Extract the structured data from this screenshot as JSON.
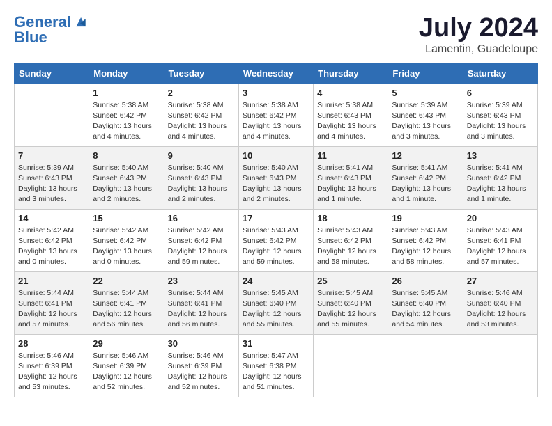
{
  "header": {
    "logo_line1": "General",
    "logo_line2": "Blue",
    "month_year": "July 2024",
    "location": "Lamentin, Guadeloupe"
  },
  "weekdays": [
    "Sunday",
    "Monday",
    "Tuesday",
    "Wednesday",
    "Thursday",
    "Friday",
    "Saturday"
  ],
  "weeks": [
    [
      {
        "day": "",
        "empty": true
      },
      {
        "day": "1",
        "sunrise": "5:38 AM",
        "sunset": "6:42 PM",
        "daylight": "13 hours and 4 minutes."
      },
      {
        "day": "2",
        "sunrise": "5:38 AM",
        "sunset": "6:42 PM",
        "daylight": "13 hours and 4 minutes."
      },
      {
        "day": "3",
        "sunrise": "5:38 AM",
        "sunset": "6:42 PM",
        "daylight": "13 hours and 4 minutes."
      },
      {
        "day": "4",
        "sunrise": "5:38 AM",
        "sunset": "6:43 PM",
        "daylight": "13 hours and 4 minutes."
      },
      {
        "day": "5",
        "sunrise": "5:39 AM",
        "sunset": "6:43 PM",
        "daylight": "13 hours and 3 minutes."
      },
      {
        "day": "6",
        "sunrise": "5:39 AM",
        "sunset": "6:43 PM",
        "daylight": "13 hours and 3 minutes."
      }
    ],
    [
      {
        "day": "7",
        "sunrise": "5:39 AM",
        "sunset": "6:43 PM",
        "daylight": "13 hours and 3 minutes."
      },
      {
        "day": "8",
        "sunrise": "5:40 AM",
        "sunset": "6:43 PM",
        "daylight": "13 hours and 2 minutes."
      },
      {
        "day": "9",
        "sunrise": "5:40 AM",
        "sunset": "6:43 PM",
        "daylight": "13 hours and 2 minutes."
      },
      {
        "day": "10",
        "sunrise": "5:40 AM",
        "sunset": "6:43 PM",
        "daylight": "13 hours and 2 minutes."
      },
      {
        "day": "11",
        "sunrise": "5:41 AM",
        "sunset": "6:43 PM",
        "daylight": "13 hours and 1 minute."
      },
      {
        "day": "12",
        "sunrise": "5:41 AM",
        "sunset": "6:42 PM",
        "daylight": "13 hours and 1 minute."
      },
      {
        "day": "13",
        "sunrise": "5:41 AM",
        "sunset": "6:42 PM",
        "daylight": "13 hours and 1 minute."
      }
    ],
    [
      {
        "day": "14",
        "sunrise": "5:42 AM",
        "sunset": "6:42 PM",
        "daylight": "13 hours and 0 minutes."
      },
      {
        "day": "15",
        "sunrise": "5:42 AM",
        "sunset": "6:42 PM",
        "daylight": "13 hours and 0 minutes."
      },
      {
        "day": "16",
        "sunrise": "5:42 AM",
        "sunset": "6:42 PM",
        "daylight": "12 hours and 59 minutes."
      },
      {
        "day": "17",
        "sunrise": "5:43 AM",
        "sunset": "6:42 PM",
        "daylight": "12 hours and 59 minutes."
      },
      {
        "day": "18",
        "sunrise": "5:43 AM",
        "sunset": "6:42 PM",
        "daylight": "12 hours and 58 minutes."
      },
      {
        "day": "19",
        "sunrise": "5:43 AM",
        "sunset": "6:42 PM",
        "daylight": "12 hours and 58 minutes."
      },
      {
        "day": "20",
        "sunrise": "5:43 AM",
        "sunset": "6:41 PM",
        "daylight": "12 hours and 57 minutes."
      }
    ],
    [
      {
        "day": "21",
        "sunrise": "5:44 AM",
        "sunset": "6:41 PM",
        "daylight": "12 hours and 57 minutes."
      },
      {
        "day": "22",
        "sunrise": "5:44 AM",
        "sunset": "6:41 PM",
        "daylight": "12 hours and 56 minutes."
      },
      {
        "day": "23",
        "sunrise": "5:44 AM",
        "sunset": "6:41 PM",
        "daylight": "12 hours and 56 minutes."
      },
      {
        "day": "24",
        "sunrise": "5:45 AM",
        "sunset": "6:40 PM",
        "daylight": "12 hours and 55 minutes."
      },
      {
        "day": "25",
        "sunrise": "5:45 AM",
        "sunset": "6:40 PM",
        "daylight": "12 hours and 55 minutes."
      },
      {
        "day": "26",
        "sunrise": "5:45 AM",
        "sunset": "6:40 PM",
        "daylight": "12 hours and 54 minutes."
      },
      {
        "day": "27",
        "sunrise": "5:46 AM",
        "sunset": "6:40 PM",
        "daylight": "12 hours and 53 minutes."
      }
    ],
    [
      {
        "day": "28",
        "sunrise": "5:46 AM",
        "sunset": "6:39 PM",
        "daylight": "12 hours and 53 minutes."
      },
      {
        "day": "29",
        "sunrise": "5:46 AM",
        "sunset": "6:39 PM",
        "daylight": "12 hours and 52 minutes."
      },
      {
        "day": "30",
        "sunrise": "5:46 AM",
        "sunset": "6:39 PM",
        "daylight": "12 hours and 52 minutes."
      },
      {
        "day": "31",
        "sunrise": "5:47 AM",
        "sunset": "6:38 PM",
        "daylight": "12 hours and 51 minutes."
      },
      {
        "day": "",
        "empty": true
      },
      {
        "day": "",
        "empty": true
      },
      {
        "day": "",
        "empty": true
      }
    ]
  ]
}
